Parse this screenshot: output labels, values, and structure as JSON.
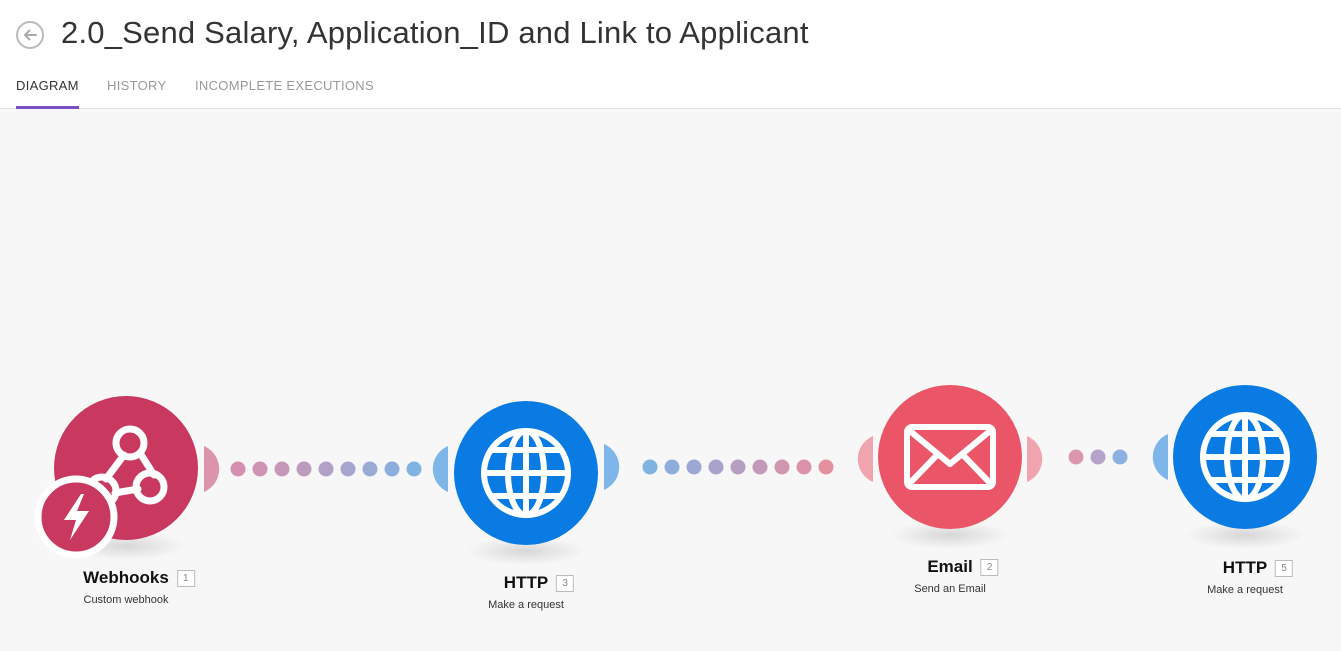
{
  "header": {
    "title": "2.0_Send Salary, Application_ID and Link to Applicant"
  },
  "tabs": [
    {
      "label": "DIAGRAM",
      "active": true
    },
    {
      "label": "HISTORY",
      "active": false
    },
    {
      "label": "INCOMPLETE EXECUTIONS",
      "active": false
    }
  ],
  "modules": [
    {
      "name": "Webhooks",
      "id": "1",
      "subtitle": "Custom webhook",
      "color": "#c8385f",
      "icon": "webhook-icon"
    },
    {
      "name": "HTTP",
      "id": "3",
      "subtitle": "Make a request",
      "color": "#0a7be3",
      "icon": "globe-icon"
    },
    {
      "name": "Email",
      "id": "2",
      "subtitle": "Send an Email",
      "color": "#ea5668",
      "icon": "envelope-icon"
    },
    {
      "name": "HTTP",
      "id": "5",
      "subtitle": "Make a request",
      "color": "#0a7be3",
      "icon": "globe-icon"
    }
  ],
  "colors": {
    "accent": "#7b4fc4",
    "webhook": "#c8385f",
    "http": "#0a7be3",
    "email": "#ea5668"
  }
}
